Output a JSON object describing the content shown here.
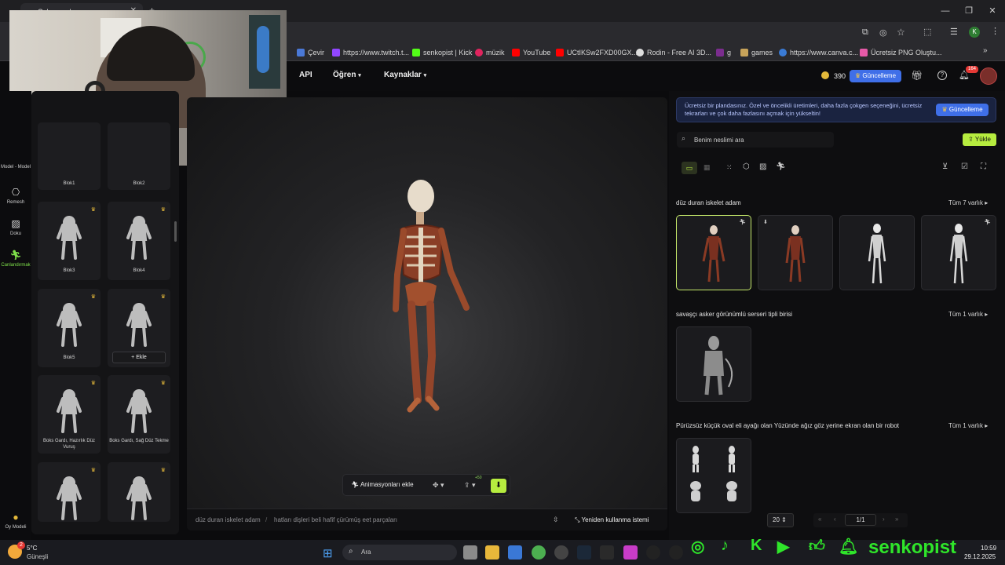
{
  "browser": {
    "tab_title": "Çalışma alanı",
    "bookmarks": [
      "Çevir",
      "https://www.twitch.t...",
      "senkopist | Kick",
      "müzik",
      "YouTube",
      "UCtIKSw2FXD00GX...",
      "Rodin - Free AI 3D...",
      "g",
      "games",
      "https://www.canva.c...",
      "Ücretsiz PNG Oluştu..."
    ],
    "profile_initial": "K"
  },
  "header": {
    "nav": [
      "API",
      "Öğren",
      "Kaynaklar"
    ],
    "credits": "390",
    "upgrade_label": "Güncelleme",
    "notif_badge": "164"
  },
  "rail": {
    "items": [
      {
        "label": "Model - Model"
      },
      {
        "label": "Remesh"
      },
      {
        "label": "Doku"
      },
      {
        "label": "Canlandırmak"
      }
    ],
    "bottom_label": "Oy Modeli"
  },
  "library": {
    "cards": [
      {
        "label": "Blok1"
      },
      {
        "label": "Blok2"
      },
      {
        "label": "Blok3"
      },
      {
        "label": "Blok4"
      },
      {
        "label": "Blok5"
      },
      {
        "label": "Ekle"
      },
      {
        "label": "Boks Gardı, Hazırlık Düz Vuruş"
      },
      {
        "label": "Boks Gardı, Sağ Düz Tekme"
      },
      {
        "label": ""
      },
      {
        "label": ""
      }
    ]
  },
  "viewer": {
    "add_anim_label": "Animasyonları ekle",
    "badge": "+50",
    "breadcrumb": [
      "düz duran iskelet adam",
      "hatları dişleri beli hafif çürümüş eet parçaları"
    ],
    "reuse_label": "Yeniden kullanma istemi"
  },
  "right": {
    "promo_text": "Ücretsiz bir plandasınız. Özel ve öncelikli üretimleri, daha fazla çokgen seçeneğini, ücretsiz tekrarları ve çok daha fazlasını açmak için yükseltin!",
    "promo_button": "Güncelleme",
    "search_placeholder": "Benim neslimi ara",
    "upload_label": "Yükle",
    "sections": [
      {
        "title": "düz duran iskelet adam",
        "link": "Tüm 7 varlık"
      },
      {
        "title": "savaşçı asker görünümlü serseri tipli birisi",
        "link": "Tüm 1 varlık"
      },
      {
        "title": "Pürüzsüz küçük oval eli ayağı olan Yüzünde ağız göz yerine ekran olan bir robot",
        "link": "Tüm 1 varlık"
      }
    ],
    "page_size": "20",
    "page": "1/1"
  },
  "taskbar": {
    "temp": "5°C",
    "weather": "Güneşli",
    "search": "Ara",
    "time": "10:59",
    "date": "29.12.2025",
    "weather_badge": "2",
    "streamer": "senkopist"
  }
}
